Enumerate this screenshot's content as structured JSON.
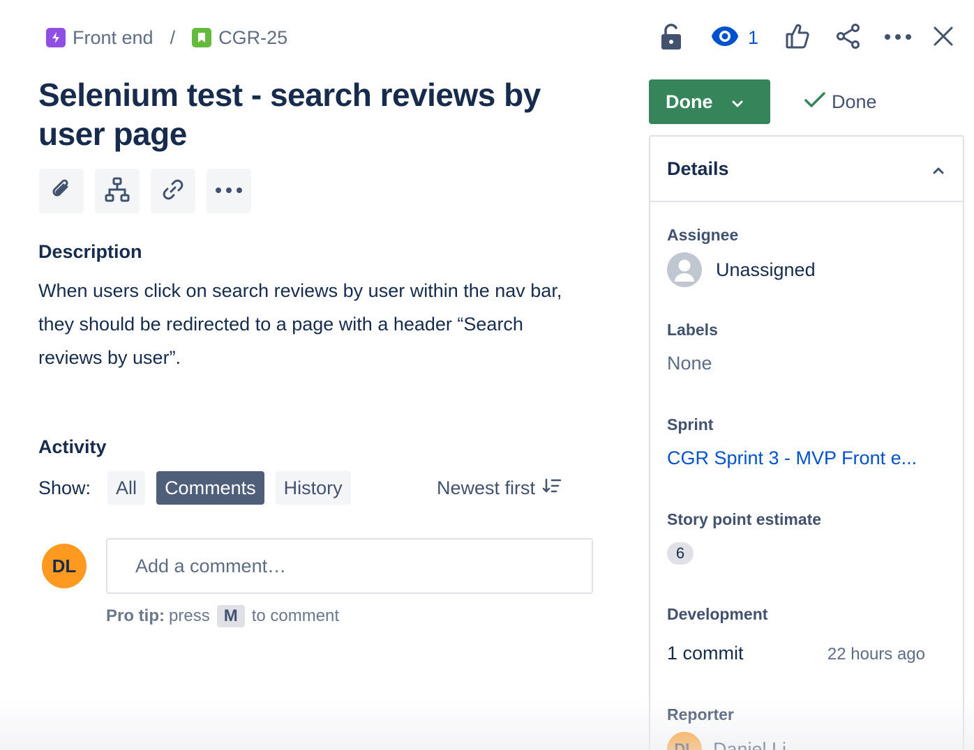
{
  "breadcrumb": {
    "parent": "Front end",
    "separator": "/",
    "issue_key": "CGR-25"
  },
  "title": "Selenium test - search reviews by user page",
  "toolbar": {
    "attach_icon": "paperclip-icon",
    "child_issue_icon": "hierarchy-icon",
    "link_icon": "link-icon",
    "more_icon": "more-icon"
  },
  "description": {
    "label": "Description",
    "text": "When users click on search reviews by user within the nav bar, they should be redirected to a page with a header “Search reviews by user”."
  },
  "activity": {
    "label": "Activity",
    "show_label": "Show:",
    "filters": [
      "All",
      "Comments",
      "History"
    ],
    "active_filter": "Comments",
    "sort_label": "Newest first",
    "avatar_initials": "DL",
    "comment_placeholder": "Add a comment…",
    "protip_bold": "Pro tip:",
    "protip_press": "press",
    "protip_key": "M",
    "protip_rest": "to comment"
  },
  "header_actions": {
    "watch_count": "1"
  },
  "status": {
    "button_label": "Done",
    "resolution": "Done",
    "color": "#36855a"
  },
  "details": {
    "header": "Details",
    "assignee_label": "Assignee",
    "assignee_value": "Unassigned",
    "labels_label": "Labels",
    "labels_value": "None",
    "sprint_label": "Sprint",
    "sprint_value": "CGR Sprint 3 - MVP Front e...",
    "story_points_label": "Story point estimate",
    "story_points_value": "6",
    "development_label": "Development",
    "development_value": "1 commit",
    "development_time": "22 hours ago",
    "reporter_label": "Reporter",
    "reporter_initials": "DL",
    "reporter_name": "Daniel Li"
  }
}
